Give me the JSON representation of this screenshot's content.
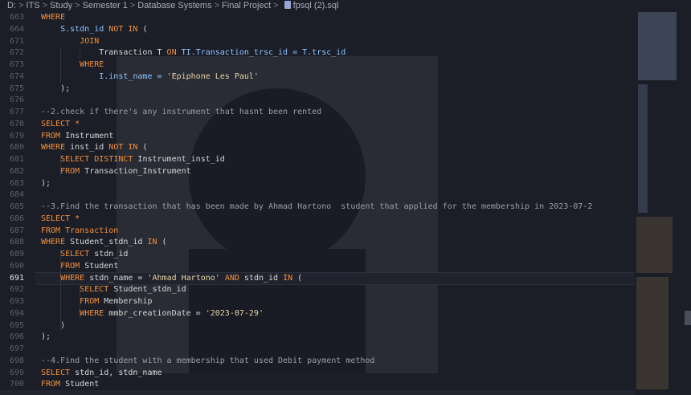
{
  "breadcrumb": {
    "items": [
      "D:",
      "ITS",
      "Study",
      "Semester 1",
      "Database Systems",
      "Final Project",
      "fpsql (2).sql"
    ],
    "separator": ">"
  },
  "editor": {
    "active_line": "691",
    "lines": [
      {
        "num": "663",
        "tokens": [
          {
            "t": "WHERE",
            "c": "kw"
          }
        ]
      },
      {
        "num": "664",
        "tokens": [
          {
            "t": "    S.stdn_id ",
            "c": "id"
          },
          {
            "t": "NOT IN",
            "c": "kw"
          },
          {
            "t": " (",
            "c": ""
          }
        ]
      },
      {
        "num": "671",
        "tokens": [
          {
            "t": "        ",
            "c": ""
          },
          {
            "t": "JOIN",
            "c": "kw"
          }
        ]
      },
      {
        "num": "672",
        "tokens": [
          {
            "t": "            Transaction T ",
            "c": ""
          },
          {
            "t": "ON",
            "c": "kw"
          },
          {
            "t": " TI.Transaction_trsc_id = T.trsc_id",
            "c": "id"
          }
        ]
      },
      {
        "num": "673",
        "tokens": [
          {
            "t": "        ",
            "c": ""
          },
          {
            "t": "WHERE",
            "c": "kw"
          }
        ]
      },
      {
        "num": "674",
        "tokens": [
          {
            "t": "            I.inst_name = ",
            "c": "id"
          },
          {
            "t": "'Epiphone Les Paul'",
            "c": "str"
          }
        ]
      },
      {
        "num": "675",
        "tokens": [
          {
            "t": "    );",
            "c": ""
          }
        ]
      },
      {
        "num": "676",
        "tokens": []
      },
      {
        "num": "677",
        "tokens": [
          {
            "t": "--2.check if there's any instrument that hasnt been rented",
            "c": "cm"
          }
        ]
      },
      {
        "num": "678",
        "tokens": [
          {
            "t": "SELECT *",
            "c": "kw"
          }
        ]
      },
      {
        "num": "679",
        "tokens": [
          {
            "t": "FROM",
            "c": "kw"
          },
          {
            "t": " Instrument",
            "c": ""
          }
        ]
      },
      {
        "num": "680",
        "tokens": [
          {
            "t": "WHERE",
            "c": "kw"
          },
          {
            "t": " inst_id ",
            "c": ""
          },
          {
            "t": "NOT IN",
            "c": "kw"
          },
          {
            "t": " (",
            "c": ""
          }
        ]
      },
      {
        "num": "681",
        "tokens": [
          {
            "t": "    ",
            "c": ""
          },
          {
            "t": "SELECT DISTINCT",
            "c": "kw"
          },
          {
            "t": " Instrument_inst_id",
            "c": ""
          }
        ]
      },
      {
        "num": "682",
        "tokens": [
          {
            "t": "    ",
            "c": ""
          },
          {
            "t": "FROM",
            "c": "kw"
          },
          {
            "t": " Transaction_Instrument",
            "c": ""
          }
        ]
      },
      {
        "num": "683",
        "tokens": [
          {
            "t": ");",
            "c": ""
          }
        ]
      },
      {
        "num": "684",
        "tokens": []
      },
      {
        "num": "685",
        "tokens": [
          {
            "t": "--3.Find the transaction that has been made by Ahmad Hartono  student that applied for the membership in 2023-07-2",
            "c": "cm"
          }
        ]
      },
      {
        "num": "686",
        "tokens": [
          {
            "t": "SELECT *",
            "c": "kw"
          }
        ]
      },
      {
        "num": "687",
        "tokens": [
          {
            "t": "FROM Transaction",
            "c": "kw"
          }
        ]
      },
      {
        "num": "688",
        "tokens": [
          {
            "t": "WHERE",
            "c": "kw"
          },
          {
            "t": " Student_stdn_id ",
            "c": ""
          },
          {
            "t": "IN",
            "c": "kw"
          },
          {
            "t": " (",
            "c": ""
          }
        ]
      },
      {
        "num": "689",
        "tokens": [
          {
            "t": "    ",
            "c": ""
          },
          {
            "t": "SELECT",
            "c": "kw"
          },
          {
            "t": " stdn_id",
            "c": ""
          }
        ]
      },
      {
        "num": "690",
        "tokens": [
          {
            "t": "    ",
            "c": ""
          },
          {
            "t": "FROM",
            "c": "kw"
          },
          {
            "t": " Student",
            "c": ""
          }
        ]
      },
      {
        "num": "691",
        "tokens": [
          {
            "t": "    ",
            "c": ""
          },
          {
            "t": "WHERE",
            "c": "kw"
          },
          {
            "t": " stdn_name = ",
            "c": ""
          },
          {
            "t": "'Ahmad Hartono'",
            "c": "str"
          },
          {
            "t": " ",
            "c": ""
          },
          {
            "t": "AND",
            "c": "kw"
          },
          {
            "t": " stdn_id ",
            "c": ""
          },
          {
            "t": "IN",
            "c": "kw"
          },
          {
            "t": " (",
            "c": ""
          }
        ]
      },
      {
        "num": "692",
        "tokens": [
          {
            "t": "        ",
            "c": ""
          },
          {
            "t": "SELECT",
            "c": "kw"
          },
          {
            "t": " Student_stdn_id",
            "c": ""
          }
        ]
      },
      {
        "num": "693",
        "tokens": [
          {
            "t": "        ",
            "c": ""
          },
          {
            "t": "FROM",
            "c": "kw"
          },
          {
            "t": " Membership",
            "c": ""
          }
        ]
      },
      {
        "num": "694",
        "tokens": [
          {
            "t": "        ",
            "c": ""
          },
          {
            "t": "WHERE",
            "c": "kw"
          },
          {
            "t": " mmbr_creationDate = ",
            "c": ""
          },
          {
            "t": "'2023-07-29'",
            "c": "str"
          }
        ]
      },
      {
        "num": "695",
        "tokens": [
          {
            "t": "    )",
            "c": ""
          }
        ]
      },
      {
        "num": "696",
        "tokens": [
          {
            "t": ");",
            "c": ""
          }
        ]
      },
      {
        "num": "697",
        "tokens": []
      },
      {
        "num": "698",
        "tokens": [
          {
            "t": "--4.Find the student with a membership that used Debit payment method",
            "c": "cm"
          }
        ]
      },
      {
        "num": "699",
        "tokens": [
          {
            "t": "SELECT",
            "c": "kw"
          },
          {
            "t": " stdn_id, stdn_name",
            "c": ""
          }
        ]
      },
      {
        "num": "700",
        "tokens": [
          {
            "t": "FROM",
            "c": "kw"
          },
          {
            "t": " Student",
            "c": ""
          }
        ]
      }
    ]
  },
  "colors": {
    "keyword": "#f28f3b",
    "string": "#e8d2a6",
    "comment": "#9a9fab",
    "background": "#1b1e27"
  }
}
